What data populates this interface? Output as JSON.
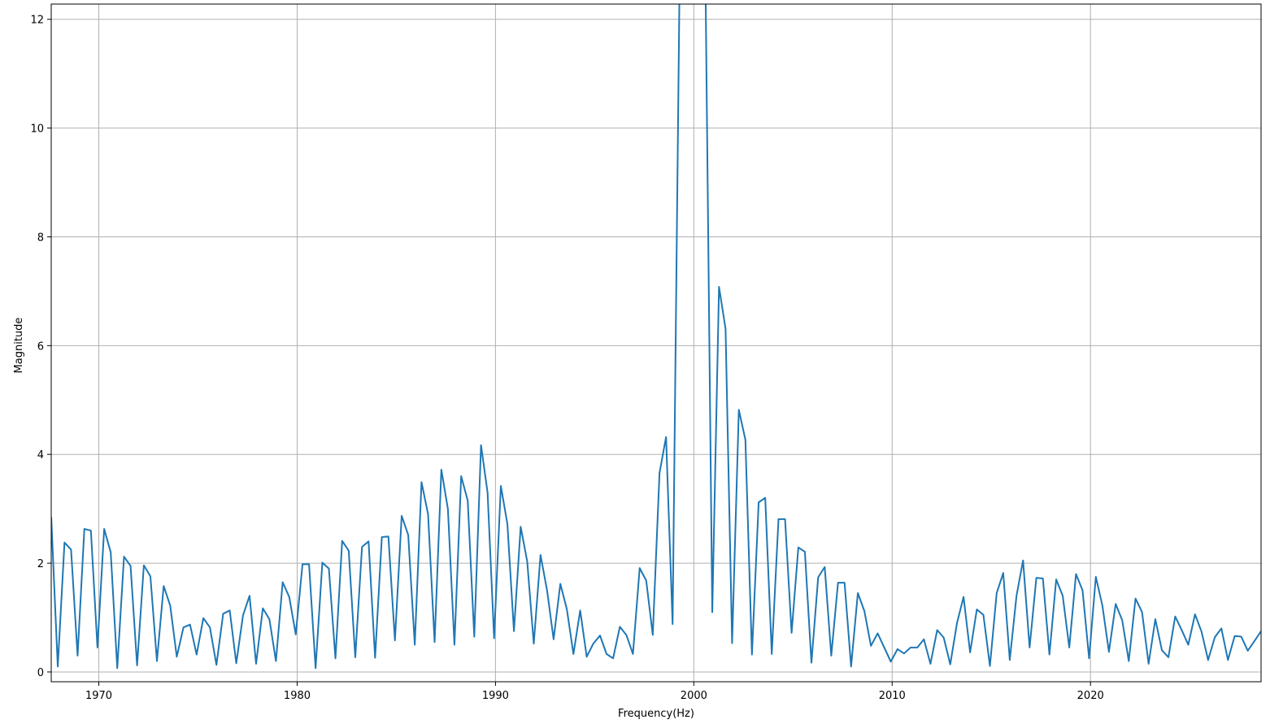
{
  "chart_data": {
    "type": "line",
    "title": "",
    "xlabel": "Frequency(Hz)",
    "ylabel": "Magnitude",
    "xlim": [
      1967.6,
      2028.6
    ],
    "ylim": [
      -0.18,
      12.28
    ],
    "xticks": [
      1970,
      1980,
      1990,
      2000,
      2010,
      2020
    ],
    "yticks": [
      0,
      2,
      4,
      6,
      8,
      10,
      12
    ],
    "grid": true,
    "legend": "none",
    "line_color": "#1f77b4",
    "series": [
      {
        "x": [
          1967.6,
          1967.93,
          1968.27,
          1968.6,
          1968.93,
          1969.27,
          1969.6,
          1969.93,
          1970.27,
          1970.6,
          1970.93,
          1971.27,
          1971.6,
          1971.93,
          1972.27,
          1972.6,
          1972.93,
          1973.27,
          1973.6,
          1973.93,
          1974.27,
          1974.6,
          1974.93,
          1975.27,
          1975.6,
          1975.93,
          1976.27,
          1976.6,
          1976.93,
          1977.27,
          1977.6,
          1977.93,
          1978.27,
          1978.6,
          1978.93,
          1979.27,
          1979.6,
          1979.93,
          1980.27,
          1980.6,
          1980.93,
          1981.27,
          1981.6,
          1981.93,
          1982.27,
          1982.6,
          1982.93,
          1983.27,
          1983.6,
          1983.93,
          1984.27,
          1984.6,
          1984.93,
          1985.27,
          1985.6,
          1985.93,
          1986.27,
          1986.6,
          1986.93,
          1987.27,
          1987.6,
          1987.93,
          1988.27,
          1988.6,
          1988.93,
          1989.27,
          1989.6,
          1989.93,
          1990.27,
          1990.6,
          1990.93,
          1991.27,
          1991.6,
          1991.93,
          1992.27,
          1992.6,
          1992.93,
          1993.27,
          1993.6,
          1993.93,
          1994.27,
          1994.6,
          1994.93,
          1995.27,
          1995.6,
          1995.93,
          1996.27,
          1996.6,
          1996.93,
          1997.27,
          1997.6,
          1997.93,
          1998.27,
          1998.6,
          1998.93,
          1999.27,
          1999.6,
          1999.93,
          2000.27,
          2000.6,
          2000.93,
          2001.27,
          2001.6,
          2001.93,
          2002.27,
          2002.6,
          2002.93,
          2003.27,
          2003.6,
          2003.93,
          2004.27,
          2004.6,
          2004.93,
          2005.27,
          2005.6,
          2005.93,
          2006.27,
          2006.6,
          2006.93,
          2007.27,
          2007.6,
          2007.93,
          2008.27,
          2008.6,
          2008.93,
          2009.27,
          2009.6,
          2009.93,
          2010.27,
          2010.6,
          2010.93,
          2011.27,
          2011.6,
          2011.93,
          2012.27,
          2012.6,
          2012.93,
          2013.27,
          2013.6,
          2013.93,
          2014.27,
          2014.6,
          2014.93,
          2015.27,
          2015.6,
          2015.93,
          2016.27,
          2016.6,
          2016.93,
          2017.27,
          2017.6,
          2017.93,
          2018.27,
          2018.6,
          2018.93,
          2019.27,
          2019.6,
          2019.93,
          2020.27,
          2020.6,
          2020.93,
          2021.27,
          2021.6,
          2021.93,
          2022.27,
          2022.6,
          2022.93,
          2023.27,
          2023.6,
          2023.93,
          2024.27,
          2024.6,
          2024.93,
          2025.27,
          2025.6,
          2025.93,
          2026.27,
          2026.6,
          2026.93,
          2027.27,
          2027.6,
          2027.93,
          2028.27,
          2028.6
        ],
        "y": [
          2.85,
          0.1,
          2.38,
          2.25,
          0.3,
          2.63,
          2.6,
          0.45,
          2.63,
          2.2,
          0.07,
          2.12,
          1.95,
          0.12,
          1.96,
          1.76,
          0.2,
          1.58,
          1.22,
          0.28,
          0.82,
          0.87,
          0.32,
          0.99,
          0.82,
          0.13,
          1.07,
          1.13,
          0.16,
          1.04,
          1.4,
          0.15,
          1.17,
          0.97,
          0.2,
          1.65,
          1.38,
          0.69,
          1.98,
          1.98,
          0.07,
          2.01,
          1.9,
          0.25,
          2.41,
          2.23,
          0.27,
          2.3,
          2.4,
          0.26,
          2.48,
          2.49,
          0.58,
          2.87,
          2.52,
          0.5,
          3.49,
          2.9,
          0.55,
          3.72,
          3.0,
          0.5,
          3.6,
          3.15,
          0.65,
          4.17,
          3.3,
          0.62,
          3.42,
          2.72,
          0.75,
          2.67,
          2.03,
          0.52,
          2.15,
          1.5,
          0.6,
          1.62,
          1.15,
          0.33,
          1.13,
          0.28,
          0.52,
          0.67,
          0.33,
          0.25,
          0.83,
          0.68,
          0.33,
          1.91,
          1.68,
          0.68,
          3.66,
          4.32,
          0.88,
          12.28,
          14.5,
          15.8,
          14.5,
          12.28,
          1.1,
          7.08,
          6.31,
          0.53,
          4.82,
          4.27,
          0.32,
          3.12,
          3.2,
          0.33,
          2.81,
          2.81,
          0.72,
          2.29,
          2.21,
          0.17,
          1.74,
          1.93,
          0.3,
          1.64,
          1.64,
          0.1,
          1.45,
          1.12,
          0.48,
          0.71,
          0.45,
          0.19,
          0.42,
          0.34,
          0.45,
          0.45,
          0.6,
          0.15,
          0.77,
          0.63,
          0.14,
          0.9,
          1.38,
          0.36,
          1.15,
          1.05,
          0.11,
          1.45,
          1.82,
          0.22,
          1.4,
          2.05,
          0.45,
          1.73,
          1.72,
          0.32,
          1.7,
          1.4,
          0.45,
          1.8,
          1.5,
          0.25,
          1.75,
          1.22,
          0.37,
          1.25,
          0.95,
          0.2,
          1.35,
          1.1,
          0.15,
          0.97,
          0.4,
          0.27,
          1.02,
          0.77,
          0.5,
          1.06,
          0.74,
          0.22,
          0.64,
          0.8,
          0.22,
          0.66,
          0.65,
          0.39,
          0.57,
          0.75
        ]
      }
    ]
  }
}
